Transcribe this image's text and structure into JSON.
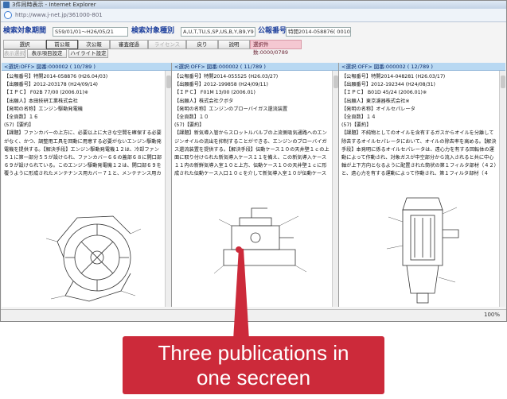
{
  "window": {
    "title": "3件同時表示 - Internet Explorer",
    "url": "http://www.j-net.jp/361000-801"
  },
  "search": {
    "period_label": "検索対象期間",
    "period_value": "S59/01/01〜H26/05/21",
    "type_label": "検索対象種別",
    "type_value": "A,U,T,TU,S,SP,US,B,Y,B9,Y9",
    "pubno_label": "公報番号",
    "pubno_value": "特開2014-058876( 0010/0789 )"
  },
  "toolbar": {
    "buttons": [
      "選択",
      "前公報",
      "次公報",
      "審査経過",
      "ライセンス",
      "戻り",
      "説明"
    ],
    "disabled": [
      4
    ],
    "selected_count": "選択件数:0000/0789"
  },
  "subbar": {
    "buttons": [
      "表示選択",
      "表示項目設定",
      "ハイライト設定"
    ],
    "disabled": [
      0
    ]
  },
  "panels": [
    {
      "header": "<選択:OFF>  図番:000002  ( 10/789 )",
      "lines": [
        "【公報番号】特開2014-058876 (H26.04/03)",
        "【出願番号】2012-203178 (H24/09/14)",
        "【ＩＰＣ】  F02B 77/00   (2006.01)※",
        "【出願人】本田技研工業株式会社",
        "【発明の名称】エンジン駆動発電機",
        "【全頁数】１６",
        "(57)【要約】"
      ],
      "body": "【課題】ファンカバーの上方に、必要以上に大きな空間を確保する必要がなく、かつ、調整用工具を回動に用意する必要がないエンジン駆動発電機を提供する。【解決手段】エンジン駆動発電機１２は、冷却ファン５１に第一部分５５が設けられ、ファンカバー６６の蓋部６８に開口部６９が設けられている。このエンジン駆動発電機１２は、開口部６９を覆うように形成されたメンテナンス用カバー７１と、メンテナンス用カバー７１をファ"
    },
    {
      "header": "<選択:OFF>  図番:000002  ( 11/789 )",
      "lines": [
        "【公報番号】特開2014-055525 (H26.03/27)",
        "【出願番号】2012-199858 (H24/09/11)",
        "【ＩＰＣ】  F01M 13/00   (2006.01)",
        "【出願人】株式会社クボタ",
        "【発明の名称】エンジンのブローバイガス還流装置",
        "【全頁数】１０",
        "(57)【要約】"
      ],
      "body": "【課題】新気導入管からスロットルバルブの上流側吸気通路へのエンジンオイルの流出を抑制することができる、エンジンのブローバイガス還流装置を提供する。【解決手段】伝動ケース１０の天井壁１ｃの上面に取り付けられた新気導入ケース１１を備え、この新気導入ケース１１内の新鮮気導入室１０と上方、伝動ケース１０の天井壁１ｃに形成された伝動ケース入口１０ｃを介して新気導入室１０が伝動ケース１０内に連通さ"
    },
    {
      "header": "<選択:OFF>  図番:000002  ( 12/789 )",
      "lines": [
        "【公報番号】特開2014-048281 (H26.03/17)",
        "【出願番号】2012-192344 (H24/08/31)",
        "【ＩＰＣ】  B01D 45/24   (2006.01)※",
        "【出願人】東京濾器株式会社※",
        "【発明の名称】オイルセパレータ",
        "【全頁数】１４",
        "(57)【要約】"
      ],
      "body": "【課題】不純物としてのオイルを含有するガスからオイルを分離して除去するオイルセパレータにおいて、オイルの除去率を高める。【解決手段】本発明に係るオイルセパレータは、遠心力を有する回転体の運動によって作動され、対象ガスが中空部分から流入されると共に中心軸が上下方向となるように配置された筒状の第１フィルタ部材（４２）と、遠心力を有する運動によって作動され、第１フィルタ部材（４"
    }
  ],
  "status": {
    "zoom": "100%"
  },
  "callout": {
    "line1": "Three publications in",
    "line2": "one secreen"
  }
}
